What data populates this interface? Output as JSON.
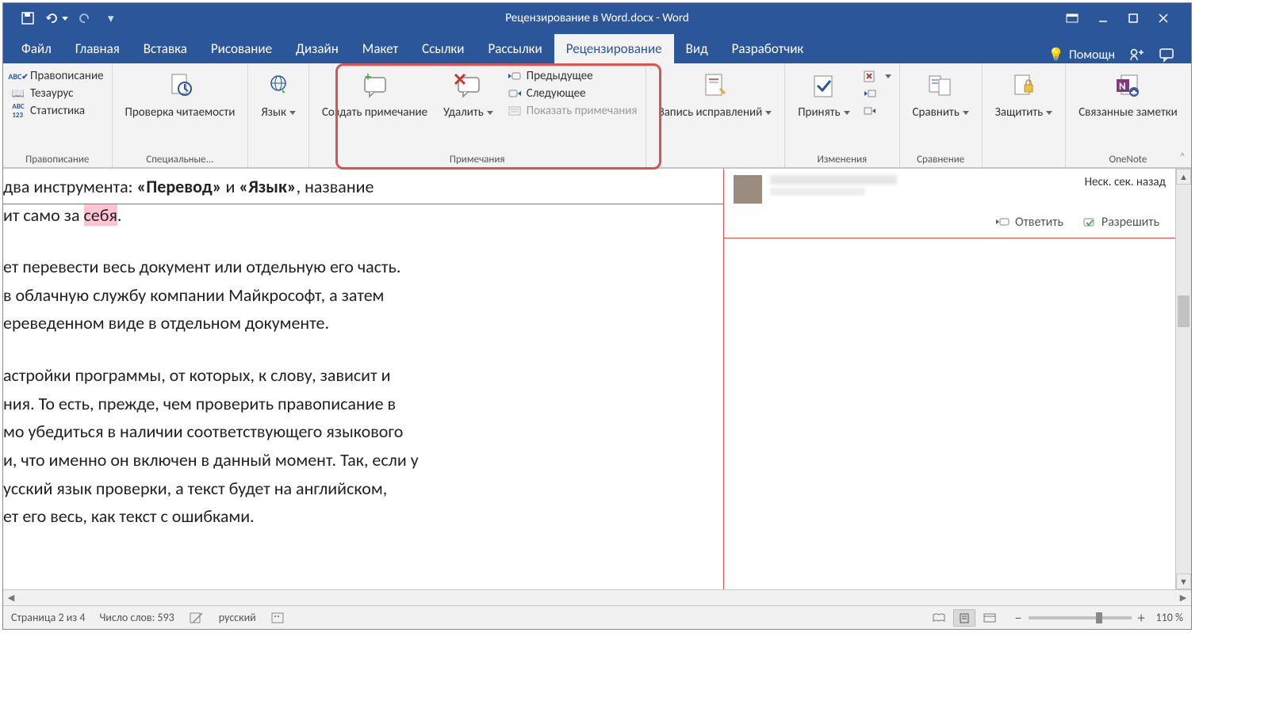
{
  "title": "Рецензирование в Word.docx  -  Word",
  "tabs": [
    "Файл",
    "Главная",
    "Вставка",
    "Рисование",
    "Дизайн",
    "Макет",
    "Ссылки",
    "Рассылки",
    "Рецензирование",
    "Вид",
    "Разработчик"
  ],
  "help_label": "Помощн",
  "ribbon": {
    "proofing": {
      "spelling": "Правописание",
      "thesaurus": "Тезаурус",
      "statistics": "Статистика",
      "group": "Правописание"
    },
    "accessibility": {
      "button": "Проверка читаемости",
      "group": "Специальные..."
    },
    "language": {
      "button": "Язык",
      "group": ""
    },
    "comments": {
      "new": "Создать примечание",
      "delete": "Удалить",
      "previous": "Предыдущее",
      "next": "Следующее",
      "show": "Показать примечания",
      "group": "Примечания"
    },
    "tracking": {
      "track": "Запись исправлений",
      "group": ""
    },
    "changes": {
      "accept": "Принять",
      "group": "Изменения"
    },
    "compare": {
      "button": "Сравнить",
      "group": "Сравнение"
    },
    "protect": {
      "button": "Защитить",
      "group": ""
    },
    "onenote": {
      "button": "Связанные заметки",
      "group": "OneNote"
    }
  },
  "document": {
    "line1a": "два инструмента: ",
    "bold1": "«Перевод»",
    "line1b": " и ",
    "bold2": "«Язык»",
    "line1c": ", название",
    "line2a": "ит само за ",
    "highlight": "себя",
    "line2b": ".",
    "para2a": "ет перевести весь документ или отдельную его часть.",
    "para2b": "в облачную службу компании Майкрософт, а затем",
    "para2c": "ереведенном виде в отдельном документе.",
    "para3a": "астройки программы, от которых, к слову, зависит и",
    "para3b": "ния. То есть, прежде, чем проверить правописание в",
    "para3c": "мо убедиться в наличии соответствующего языкового",
    "para3d": "и, что именно он включен в данный момент. Так, если у",
    "para3e": "усский язык проверки, а текст будет на английском,",
    "para3f": "ет его весь, как текст с ошибками."
  },
  "comment": {
    "time": "Неск. сек. назад",
    "reply": "Ответить",
    "resolve": "Разрешить"
  },
  "statusbar": {
    "page": "Страница 2 из 4",
    "words": "Число слов: 593",
    "language": "русский",
    "zoom": "110 %"
  }
}
